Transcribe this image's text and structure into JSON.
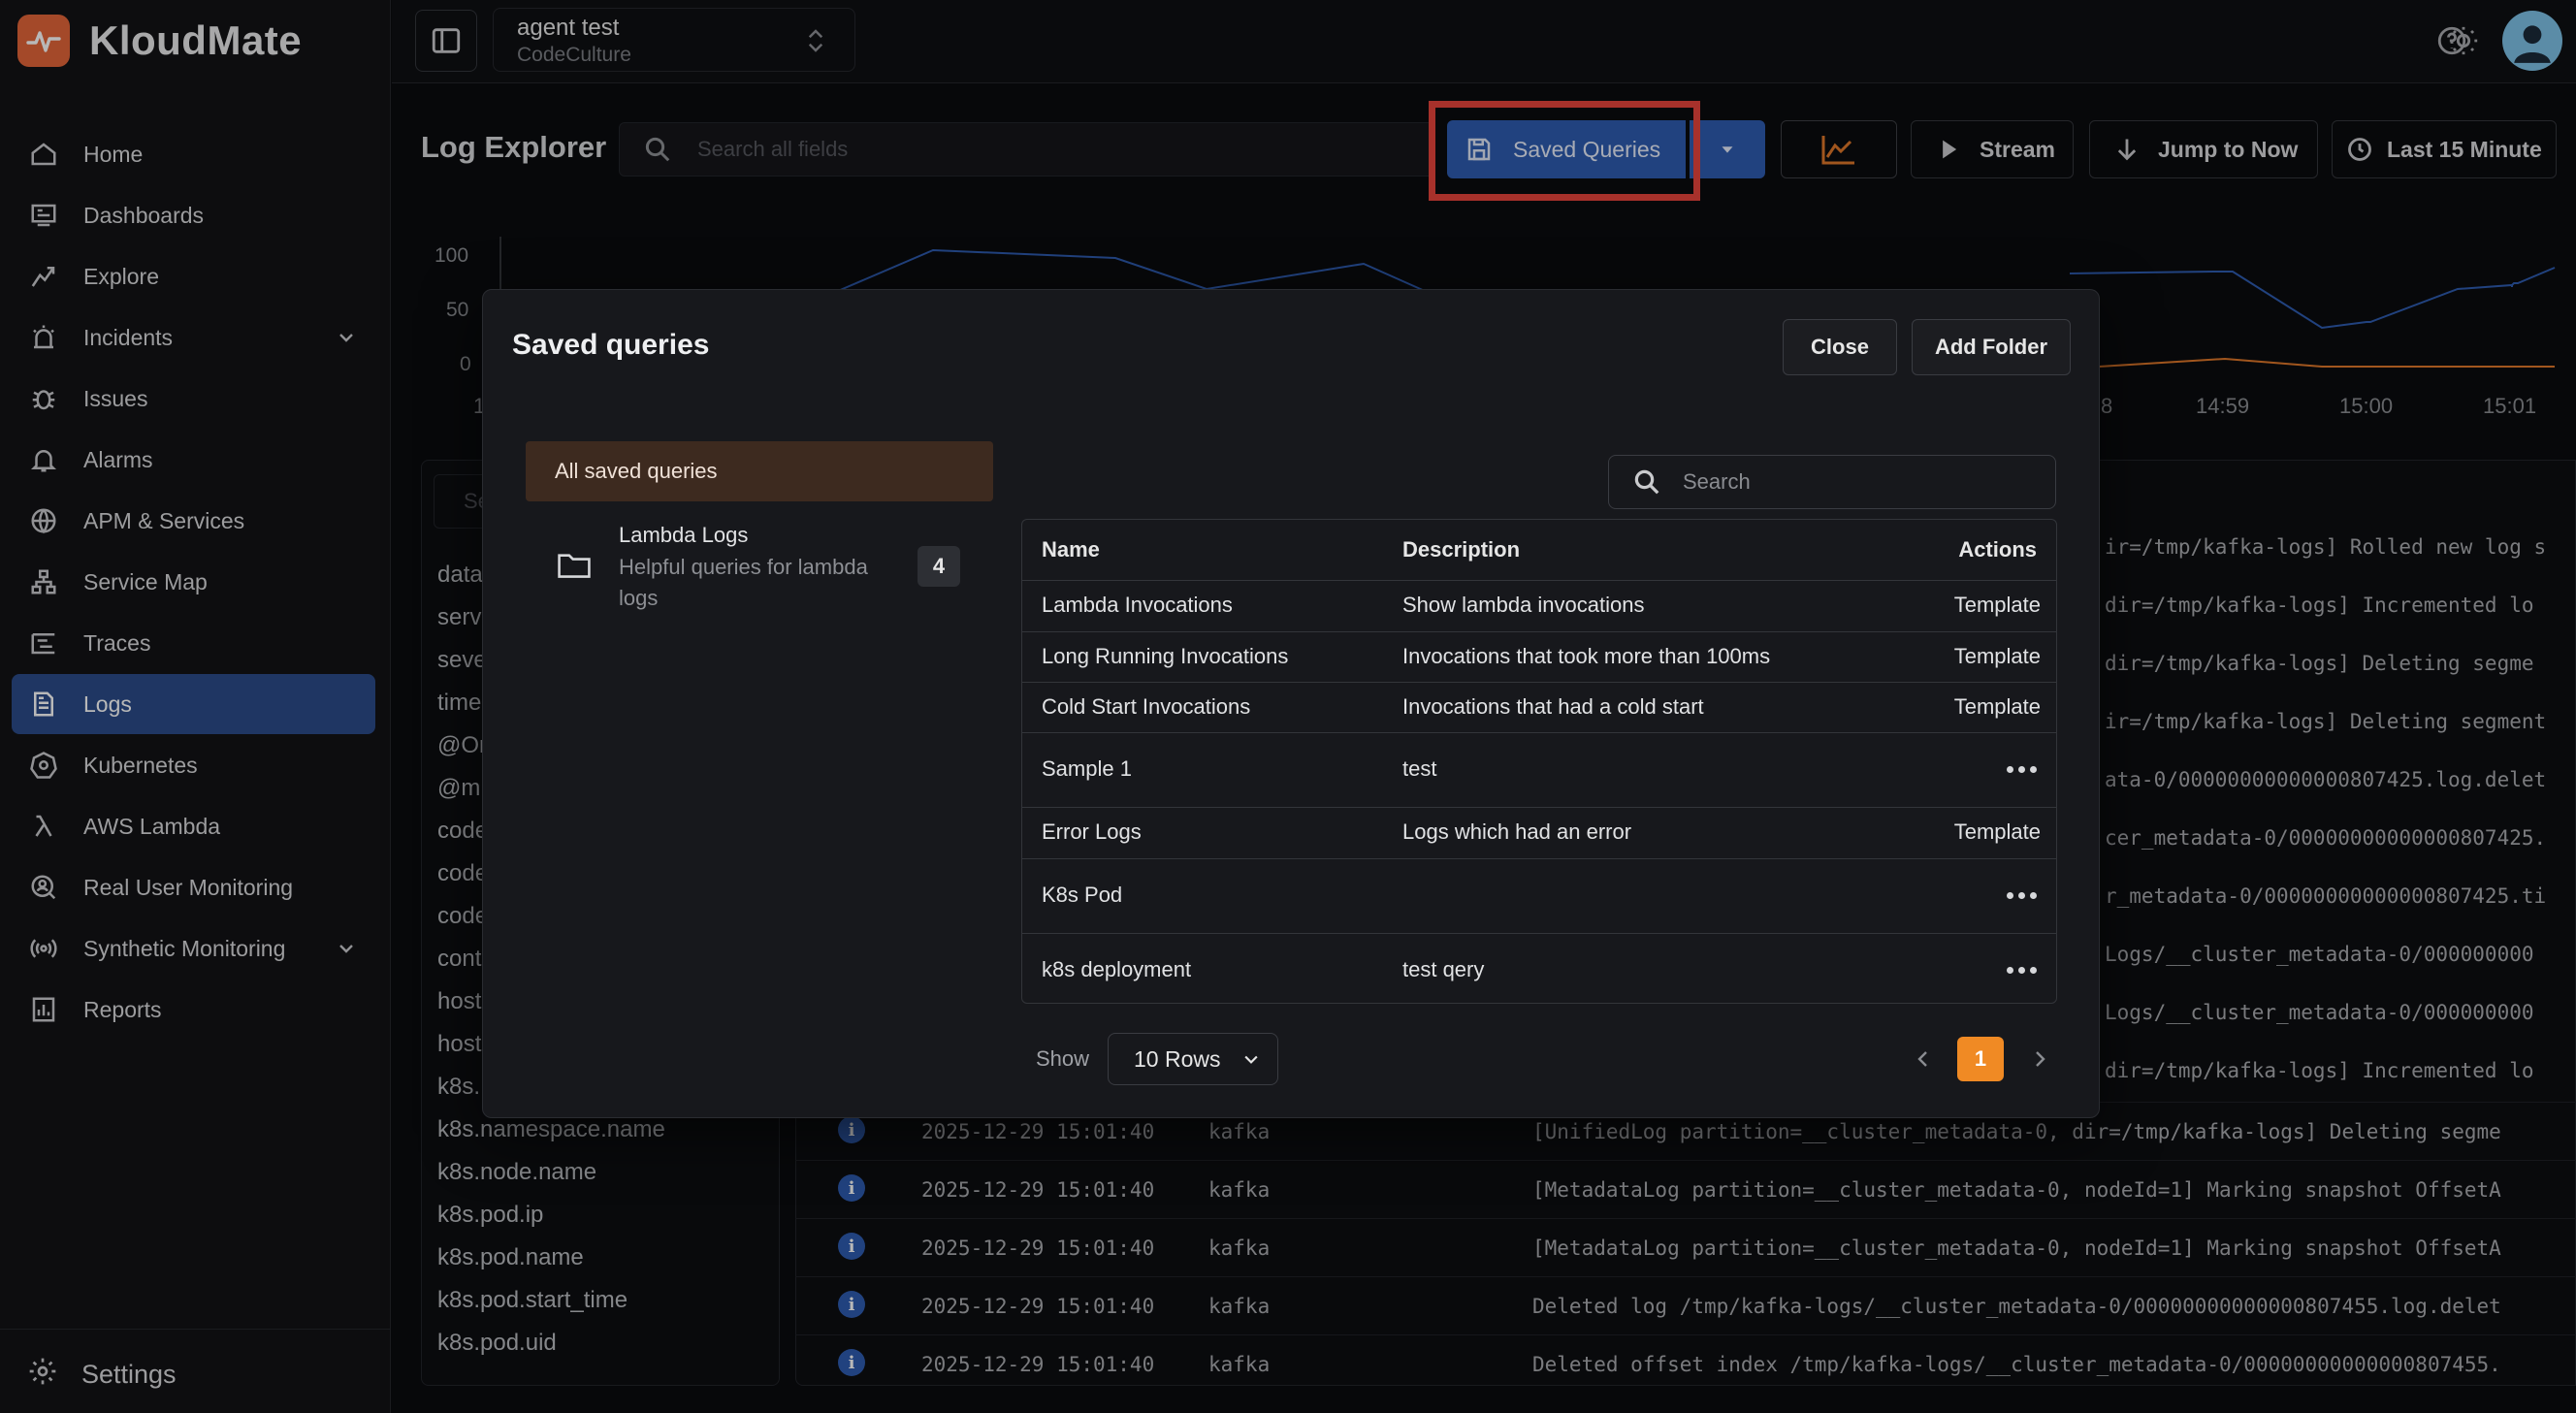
{
  "brand": {
    "name": "KloudMate"
  },
  "sidebar": {
    "items": [
      {
        "label": "Home",
        "icon": "home-icon"
      },
      {
        "label": "Dashboards",
        "icon": "dashboard-icon"
      },
      {
        "label": "Explore",
        "icon": "explore-icon"
      },
      {
        "label": "Incidents",
        "icon": "incidents-icon"
      },
      {
        "label": "Issues",
        "icon": "bug-icon"
      },
      {
        "label": "Alarms",
        "icon": "bell-icon"
      },
      {
        "label": "APM & Services",
        "icon": "globe-icon"
      },
      {
        "label": "Service Map",
        "icon": "sitemap-icon"
      },
      {
        "label": "Traces",
        "icon": "traces-icon"
      },
      {
        "label": "Logs",
        "icon": "file-icon"
      },
      {
        "label": "Kubernetes",
        "icon": "kubernetes-icon"
      },
      {
        "label": "AWS Lambda",
        "icon": "lambda-icon"
      },
      {
        "label": "Real User Monitoring",
        "icon": "rum-icon"
      },
      {
        "label": "Synthetic Monitoring",
        "icon": "broadcast-icon"
      },
      {
        "label": "Reports",
        "icon": "report-icon"
      }
    ],
    "settings_label": "Settings"
  },
  "workspace": {
    "name": "agent test",
    "org": "CodeCulture"
  },
  "toolbar": {
    "title": "Log Explorer",
    "search_placeholder": "Search all fields",
    "saved_queries_label": "Saved Queries",
    "stream_label": "Stream",
    "jump_label": "Jump to Now",
    "time_range_label": "Last 15 Minute"
  },
  "chart": {
    "y_ticks": [
      "100",
      "50",
      "0"
    ],
    "x_ticks": [
      "14:59",
      "15:00",
      "15:01"
    ],
    "partial_x_first": "1",
    "partial_x_left": "8"
  },
  "fields": {
    "items": [
      "data",
      "serv",
      "seve",
      "time",
      "@Or",
      "@m",
      "code",
      "code",
      "code",
      "cont",
      "host",
      "host",
      "k8s.",
      "k8s.namespace.name",
      "k8s.node.name",
      "k8s.pod.ip",
      "k8s.pod.name",
      "k8s.pod.start_time",
      "k8s.pod.uid"
    ],
    "search_placeholder_partial": "Se"
  },
  "logs": {
    "tail_messages": [
      "ir=/tmp/kafka-logs] Rolled new log s",
      "dir=/tmp/kafka-logs] Incremented lo",
      "dir=/tmp/kafka-logs] Deleting segme",
      "ir=/tmp/kafka-logs] Deleting segment",
      "ata-0/00000000000000807425.log.delet",
      "cer_metadata-0/00000000000000807425.",
      "r_metadata-0/00000000000000807425.ti",
      "Logs/__cluster_metadata-0/000000000",
      "Logs/__cluster_metadata-0/000000000",
      "dir=/tmp/kafka-logs] Incremented lo"
    ],
    "rows": [
      {
        "ts": "2025-12-29 15:01:40",
        "service": "kafka",
        "message": "[UnifiedLog partition=__cluster_metadata-0, dir=/tmp/kafka-logs] Deleting segme"
      },
      {
        "ts": "2025-12-29 15:01:40",
        "service": "kafka",
        "message": "[MetadataLog partition=__cluster_metadata-0, nodeId=1] Marking snapshot OffsetA"
      },
      {
        "ts": "2025-12-29 15:01:40",
        "service": "kafka",
        "message": "[MetadataLog partition=__cluster_metadata-0, nodeId=1] Marking snapshot OffsetA"
      },
      {
        "ts": "2025-12-29 15:01:40",
        "service": "kafka",
        "message": "Deleted log /tmp/kafka-logs/__cluster_metadata-0/00000000000000807455.log.delet"
      },
      {
        "ts": "2025-12-29 15:01:40",
        "service": "kafka",
        "message": "Deleted offset index /tmp/kafka-logs/__cluster_metadata-0/00000000000000807455."
      }
    ]
  },
  "modal": {
    "title": "Saved queries",
    "close_label": "Close",
    "add_folder_label": "Add Folder",
    "all_saved_label": "All saved queries",
    "folder": {
      "name": "Lambda Logs",
      "description": "Helpful queries for lambda logs",
      "count": "4"
    },
    "search_placeholder": "Search",
    "columns": {
      "name": "Name",
      "description": "Description",
      "actions": "Actions"
    },
    "rows": [
      {
        "name": "Lambda Invocations",
        "description": "Show lambda invocations",
        "action": "Template"
      },
      {
        "name": "Long Running Invocations",
        "description": "Invocations that took more than 100ms",
        "action": "Template"
      },
      {
        "name": "Cold Start Invocations",
        "description": "Invocations that had a cold start",
        "action": "Template"
      },
      {
        "name": "Sample 1",
        "description": "test",
        "action": ""
      },
      {
        "name": "Error Logs",
        "description": "Logs which had an error",
        "action": "Template"
      },
      {
        "name": "K8s Pod",
        "description": "",
        "action": ""
      },
      {
        "name": "k8s deployment",
        "description": "test qery",
        "action": ""
      }
    ],
    "show_label": "Show",
    "rows_per_page": "10 Rows",
    "current_page": "1"
  },
  "colors": {
    "accent": "#2f5cb0",
    "highlight": "#e8453c",
    "page_active": "#f08a24",
    "chart_line_blue": "#2f5cb0",
    "chart_line_orange": "#e0782a"
  }
}
